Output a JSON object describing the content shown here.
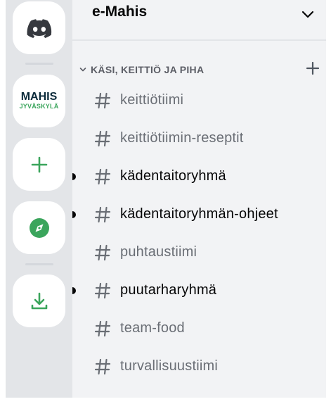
{
  "server_rail": {
    "home_icon": "discord-logo-icon",
    "servers": [
      {
        "name_line1": "MAHIS",
        "name_line2": "JYVÄSKYLÄ"
      }
    ],
    "add_server_icon": "plus-icon",
    "explore_icon": "compass-icon",
    "download_icon": "download-icon",
    "accent_color": "#3ba55c"
  },
  "guild": {
    "name": "e-Mahis",
    "chevron_icon": "chevron-down-icon"
  },
  "category": {
    "label": "KÄSI, KEITTIÖ JA PIHA",
    "add_icon": "plus-icon"
  },
  "channels": [
    {
      "name": "keittiötiimi",
      "unread": false
    },
    {
      "name": "keittiötiimin-reseptit",
      "unread": false
    },
    {
      "name": "kädentaitoryhmä",
      "unread": true
    },
    {
      "name": "kädentaitoryhmän-ohjeet",
      "unread": true
    },
    {
      "name": "puhtaustiimi",
      "unread": false
    },
    {
      "name": "puutarharyhmä",
      "unread": true
    },
    {
      "name": "team-food",
      "unread": false
    },
    {
      "name": "turvallisuustiimi",
      "unread": false
    }
  ]
}
